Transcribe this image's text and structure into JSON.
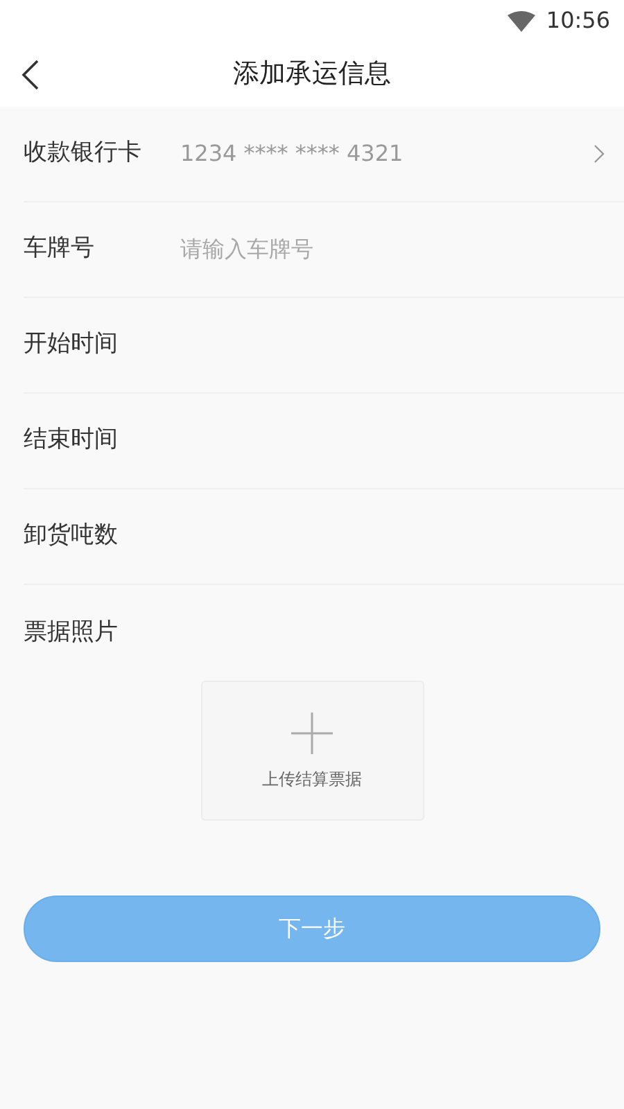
{
  "status_bar": {
    "time": "10:56"
  },
  "header": {
    "title": "添加承运信息"
  },
  "fields": [
    {
      "kind": "select",
      "label": "收款银行卡",
      "value": "1234 **** **** 4321"
    },
    {
      "kind": "input",
      "label": "车牌号",
      "placeholder": "请输入车牌号"
    },
    {
      "kind": "plain",
      "label": "开始时间"
    },
    {
      "kind": "plain",
      "label": "结束时间"
    },
    {
      "kind": "plain",
      "label": "卸货吨数"
    },
    {
      "kind": "plain",
      "label": "票据照片"
    }
  ],
  "upload": {
    "label": "上传结算票据"
  },
  "next_button": "下一步"
}
